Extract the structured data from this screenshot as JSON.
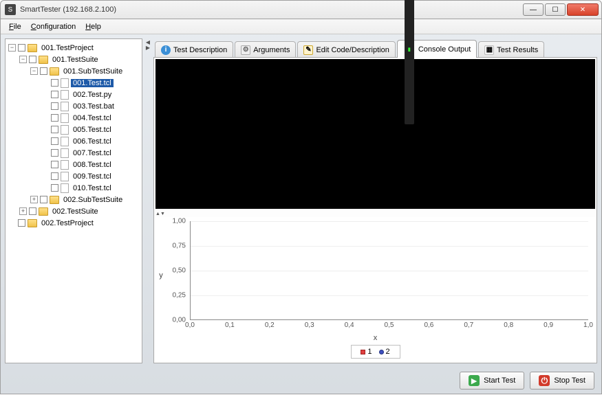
{
  "window": {
    "title": "SmartTester (192.168.2.100)"
  },
  "menu": {
    "file": "File",
    "configuration": "Configuration",
    "help": "Help"
  },
  "tree": {
    "p1": "001.TestProject",
    "s1": "001.TestSuite",
    "ss1": "001.SubTestSuite",
    "f1": "001.Test.tcl",
    "f2": "002.Test.py",
    "f3": "003.Test.bat",
    "f4": "004.Test.tcl",
    "f5": "005.Test.tcl",
    "f6": "006.Test.tcl",
    "f7": "007.Test.tcl",
    "f8": "008.Test.tcl",
    "f9": "009.Test.tcl",
    "f10": "010.Test.tcl",
    "ss2": "002.SubTestSuite",
    "s2": "002.TestSuite",
    "p2": "002.TestProject"
  },
  "tabs": {
    "desc": "Test Description",
    "args": "Arguments",
    "edit": "Edit Code/Description",
    "console": "Console Output",
    "results": "Test Results"
  },
  "buttons": {
    "start": "Start Test",
    "stop": "Stop Test"
  },
  "chart_data": {
    "type": "line",
    "title": "",
    "xlabel": "x",
    "ylabel": "y",
    "xlim": [
      0.0,
      1.0
    ],
    "ylim": [
      0.0,
      1.0
    ],
    "xticks": [
      "0,0",
      "0,1",
      "0,2",
      "0,3",
      "0,4",
      "0,5",
      "0,6",
      "0,7",
      "0,8",
      "0,9",
      "1,0"
    ],
    "yticks": [
      "0,00",
      "0,25",
      "0,50",
      "0,75",
      "1,00"
    ],
    "series": [
      {
        "name": "1",
        "values": []
      },
      {
        "name": "2",
        "values": []
      }
    ]
  }
}
